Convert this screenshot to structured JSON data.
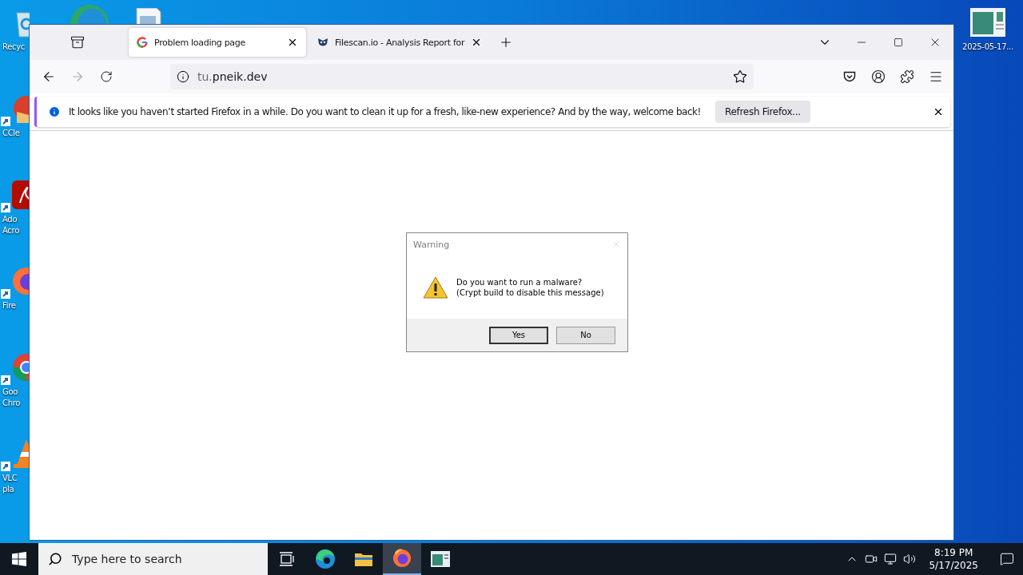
{
  "desktop": {
    "left_icons": [
      {
        "kind": "recycle",
        "label": [
          "Recyc"
        ]
      },
      {
        "kind": "ccleaner",
        "label": [
          "CCle"
        ]
      },
      {
        "kind": "acrobat",
        "label": [
          "Ado",
          "Acro"
        ]
      },
      {
        "kind": "firefox",
        "label": [
          "Fire"
        ]
      },
      {
        "kind": "chrome",
        "label": [
          "Goo",
          "Chro"
        ]
      },
      {
        "kind": "vlc",
        "label": [
          "VLC",
          "pla"
        ]
      }
    ],
    "right_icon": {
      "label": "2025-05-17..."
    }
  },
  "browser": {
    "tabs": [
      {
        "title": "Problem loading page",
        "kind": "google",
        "selected": true
      },
      {
        "title": "Filescan.io - Analysis Report for",
        "kind": "filescan",
        "selected": false
      }
    ],
    "address": {
      "prefix": "tu.",
      "domain": "pneik.dev"
    },
    "notification": {
      "message": "It looks like you haven’t started Firefox in a while. Do you want to clean it up for a fresh, like-new experience? And by the way, welcome back!",
      "button": "Refresh Firefox..."
    }
  },
  "dialog": {
    "title": "Warning",
    "lines": [
      "Do you want to run a malware?",
      "(Crypt build to disable this message)"
    ],
    "buttons": [
      {
        "label": "Yes",
        "selected": true
      },
      {
        "label": "No",
        "selected": false
      }
    ]
  },
  "taskbar": {
    "search_placeholder": "Type here to search",
    "apps": [
      {
        "kind": "edge",
        "selected": false
      },
      {
        "kind": "folder",
        "selected": false
      },
      {
        "kind": "firefox",
        "selected": true
      },
      {
        "kind": "viewer",
        "selected": false
      }
    ],
    "time": "8:19 PM",
    "date": "5/17/2025"
  }
}
